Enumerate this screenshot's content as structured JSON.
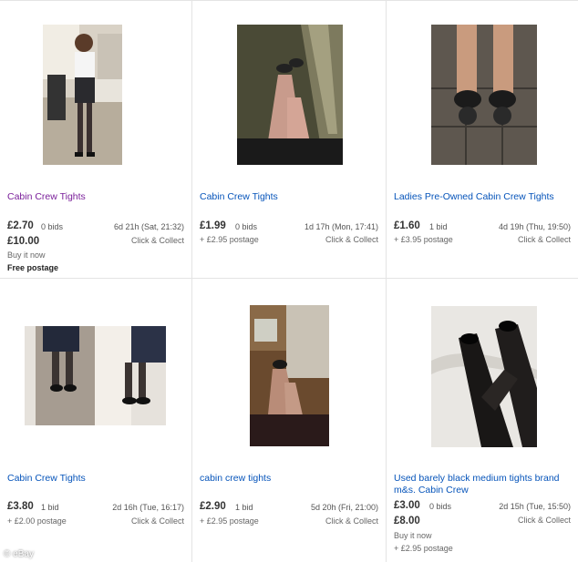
{
  "watermark": "© eBay",
  "listings": [
    {
      "title": "Cabin Crew Tights",
      "price": "£2.70",
      "bids": "0 bids",
      "time": "6d 21h (Sat, 21:32)",
      "buy_now_price": "£10.00",
      "buy_now_label": "Buy it now",
      "postage": "Free postage",
      "collect": "Click & Collect"
    },
    {
      "title": "Cabin Crew Tights",
      "price": "£1.99",
      "bids": "0 bids",
      "time": "1d 17h (Mon, 17:41)",
      "postage": "+ £2.95 postage",
      "collect": "Click & Collect"
    },
    {
      "title": "Ladies Pre-Owned Cabin Crew Tights",
      "price": "£1.60",
      "bids": "1 bid",
      "time": "4d 19h (Thu, 19:50)",
      "postage": "+ £3.95 postage",
      "collect": "Click & Collect"
    },
    {
      "title": "Cabin Crew Tights",
      "price": "£3.80",
      "bids": "1 bid",
      "time": "2d 16h (Tue, 16:17)",
      "postage": "+ £2.00 postage",
      "collect": "Click & Collect"
    },
    {
      "title": "cabin crew tights",
      "price": "£2.90",
      "bids": "1 bid",
      "time": "5d 20h (Fri, 21:00)",
      "postage": "+ £2.95 postage",
      "collect": "Click & Collect"
    },
    {
      "title": "Used barely black medium tights brand m&s. Cabin Crew",
      "price": "£3.00",
      "bids": "0 bids",
      "time": "2d 15h (Tue, 15:50)",
      "buy_now_price": "£8.00",
      "buy_now_label": "Buy it now",
      "postage": "+ £2.95 postage",
      "collect": "Click & Collect"
    }
  ]
}
